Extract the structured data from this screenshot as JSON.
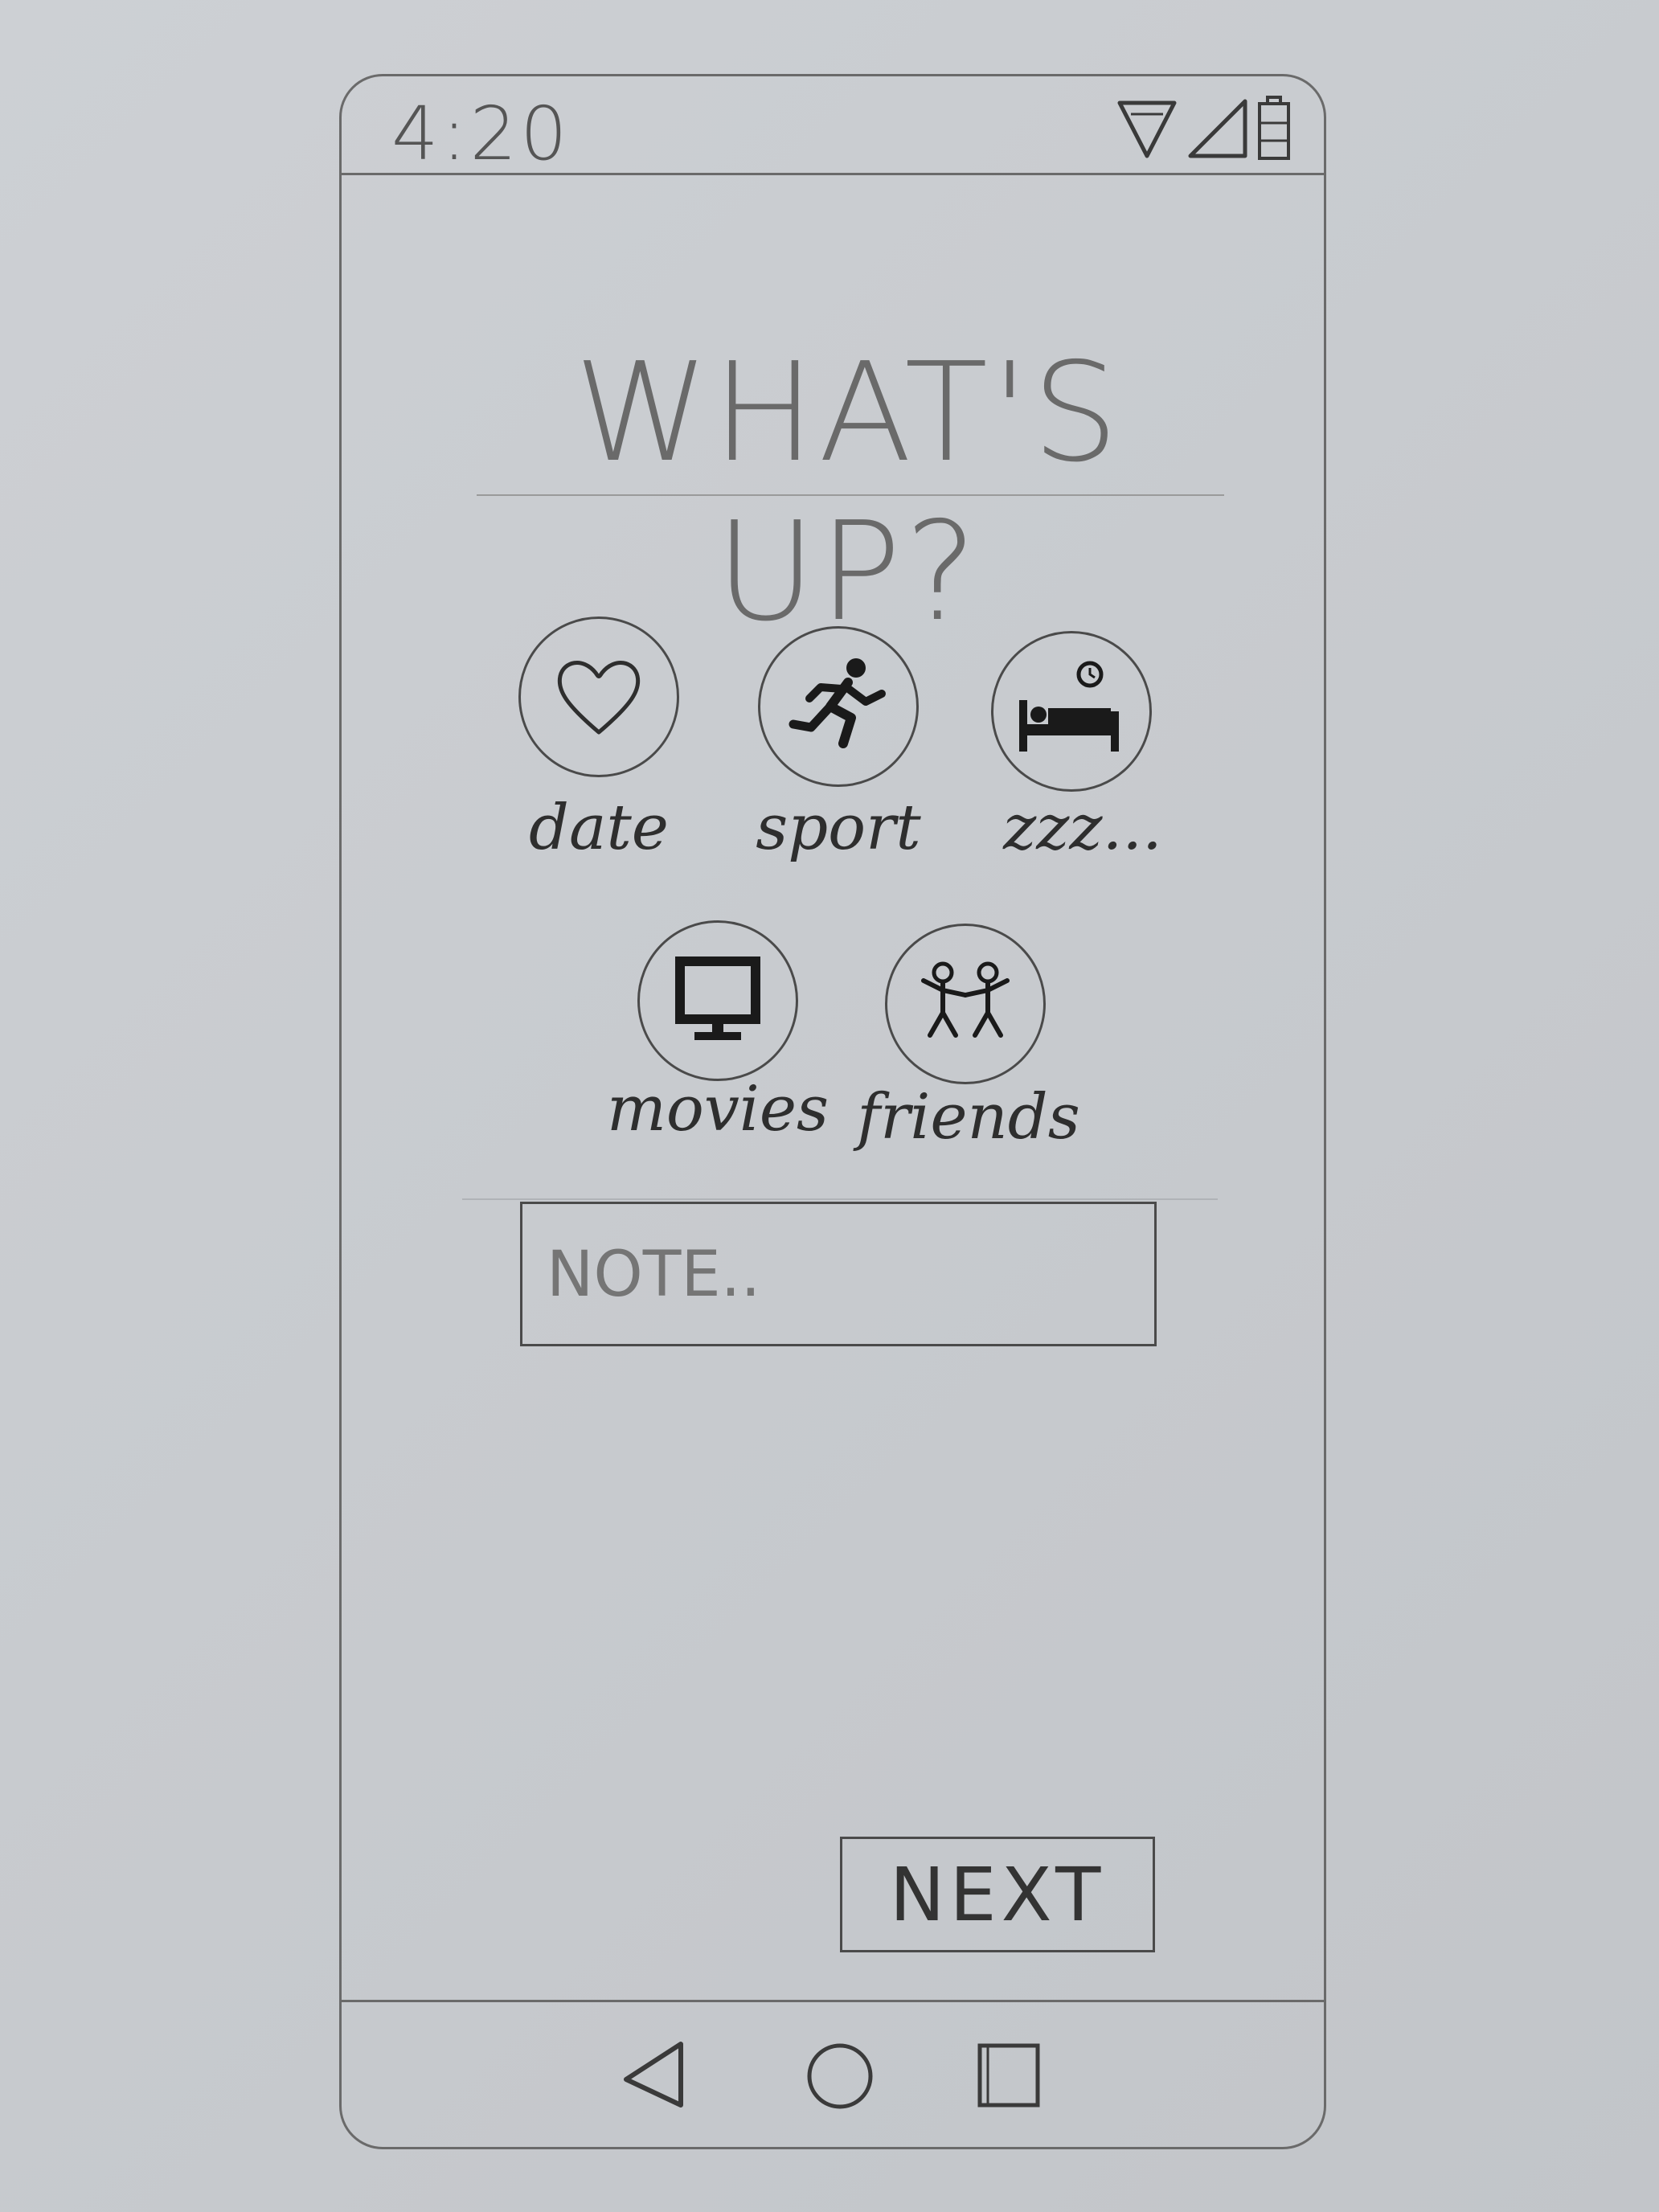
{
  "status_bar": {
    "time": "4:20",
    "icons": [
      "wifi-icon",
      "signal-icon",
      "battery-icon"
    ]
  },
  "header": {
    "title": "WHAT'S UP?"
  },
  "activities": [
    {
      "label": "date",
      "icon": "heart-icon"
    },
    {
      "label": "sport",
      "icon": "running-person-icon"
    },
    {
      "label": "zzz...",
      "icon": "bed-icon"
    },
    {
      "label": "movies",
      "icon": "monitor-icon"
    },
    {
      "label": "friends",
      "icon": "friends-icon"
    }
  ],
  "note": {
    "placeholder": "NOTE.."
  },
  "next_button": {
    "label": "NEXT"
  },
  "navigation": {
    "icons": [
      "back-icon",
      "home-icon",
      "recents-icon"
    ]
  }
}
